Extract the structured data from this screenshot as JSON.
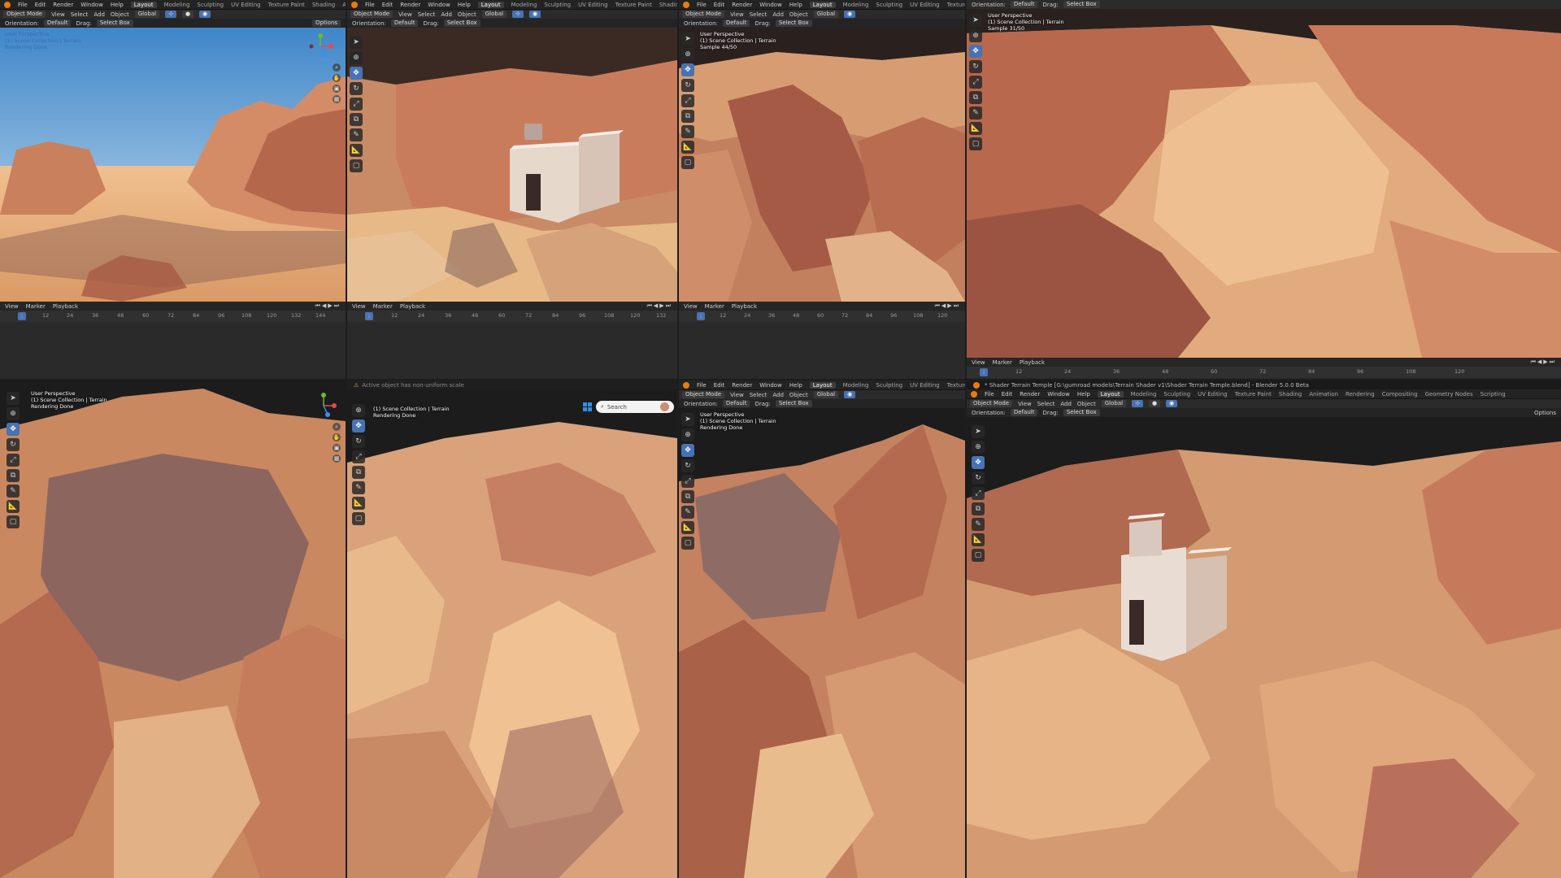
{
  "menu": [
    "File",
    "Edit",
    "Render",
    "Window",
    "Help"
  ],
  "workspaces": [
    "Layout",
    "Modeling",
    "Sculpting",
    "UV Editing",
    "Texture Paint",
    "Shading",
    "Animation",
    "Rendering",
    "Compositing",
    "Geometry Nodes",
    "Scripting"
  ],
  "header": {
    "mode": "Object Mode",
    "view_menu": [
      "View",
      "Select",
      "Add",
      "Object"
    ],
    "transform": "Global",
    "orientation_label": "Orientation:",
    "orientation_value": "Default",
    "drag_label": "Drag:",
    "drag_value": "Select Box",
    "options": "Options"
  },
  "overlay": {
    "perspective": "User Perspective",
    "collection": "(1) Scene Collection | Terrain",
    "rendering_done": "Rendering Done",
    "sample_1": "Sample 44/50",
    "sample_2": "Sample 31/50"
  },
  "timeline": {
    "menus": [
      "View",
      "Marker",
      "Playback"
    ],
    "current_frame": "1",
    "ticks_a": [
      "12",
      "24",
      "36",
      "48",
      "60",
      "72",
      "84",
      "96",
      "108",
      "120",
      "132",
      "144"
    ],
    "ticks_b": [
      "12",
      "24",
      "36",
      "48",
      "60",
      "72",
      "84",
      "96",
      "108",
      "120",
      "132"
    ],
    "ticks_c": [
      "12",
      "24",
      "36",
      "48",
      "60",
      "72",
      "84",
      "96",
      "108",
      "120"
    ]
  },
  "status_warning": "Active object has non-uniform scale",
  "search": {
    "placeholder": "Search"
  },
  "window_title": "* Shader Terrain Temple [G:\\gumroad models\\Terrain Shader v1\\Shader Terrain Temple.blend] - Blender 5.0.0 Beta",
  "colors": {
    "accent": "#4772b3",
    "sand": "#e9b27e",
    "rock": "#b8654a",
    "sky": "#5e9ad0"
  }
}
